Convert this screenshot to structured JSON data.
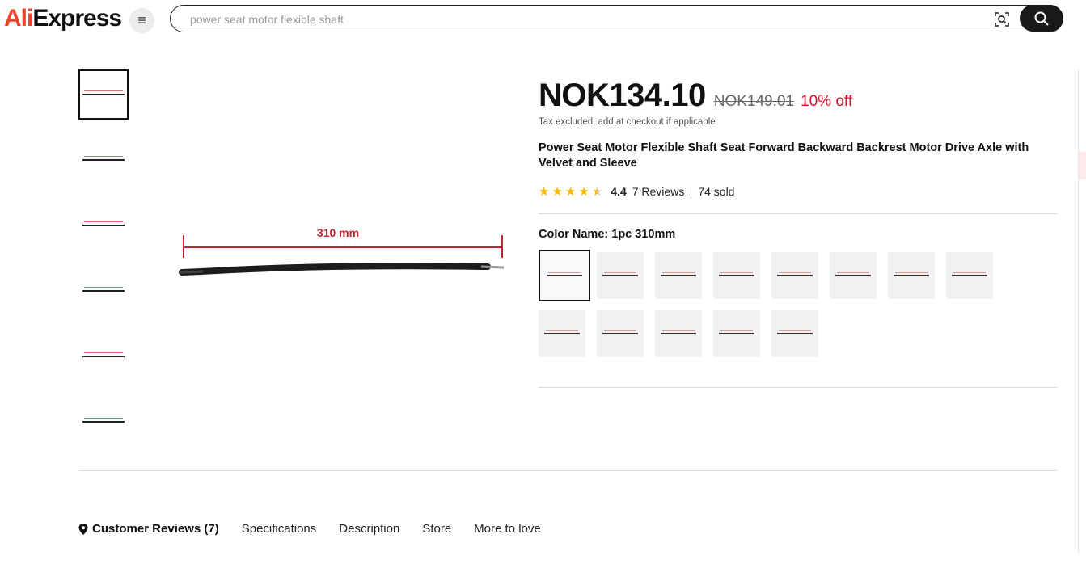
{
  "header": {
    "logo_prefix": "Ali",
    "logo_suffix": "Express",
    "search": {
      "placeholder": "power seat motor flexible shaft"
    }
  },
  "gallery": {
    "main_image_label": "310 mm",
    "thumbnail_count": 6
  },
  "product": {
    "price": "NOK134.10",
    "original_price": "NOK149.01",
    "discount": "10% off",
    "tax_note": "Tax excluded, add at checkout if applicable",
    "title": "Power Seat Motor Flexible Shaft Seat Forward Backward Backrest Motor Drive Axle with Velvet and Sleeve",
    "rating": "4.4",
    "rating_value": 4.4,
    "reviews": "7 Reviews",
    "sold": "74 sold",
    "color_label": "Color Name:",
    "color_value": "1pc 310mm",
    "swatch_count": 13,
    "selected_swatch": 0
  },
  "tabs": [
    {
      "label": "Customer Reviews (7)",
      "active": true
    },
    {
      "label": "Specifications",
      "active": false
    },
    {
      "label": "Description",
      "active": false
    },
    {
      "label": "Store",
      "active": false
    },
    {
      "label": "More to love",
      "active": false
    }
  ],
  "colors": {
    "discount": "#d4132a",
    "star": "#f7b600",
    "logo_accent": "#e8452c",
    "dimension_line": "#c0262d"
  },
  "icons": {
    "menu": "hamburger-icon",
    "camera": "image-search-icon",
    "search": "search-icon",
    "pin": "location-pin-icon"
  }
}
